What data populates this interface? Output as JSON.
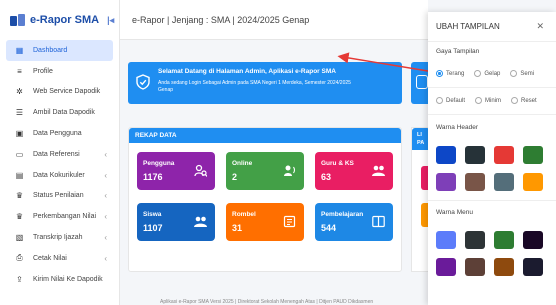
{
  "brand": {
    "name": "e-Rapor SMA",
    "toggle_icon": "sidebar-toggle-icon"
  },
  "header": {
    "breadcrumb": "e-Rapor | Jenjang : SMA | 2024/2025 Genap"
  },
  "sidebar": {
    "items": [
      {
        "label": "Dashboard",
        "icon": "dashboard-icon",
        "active": true,
        "has_submenu": false
      },
      {
        "label": "Profile",
        "icon": "profile-icon",
        "active": false,
        "has_submenu": false
      },
      {
        "label": "Web Service Dapodik",
        "icon": "gear-icon",
        "active": false,
        "has_submenu": false
      },
      {
        "label": "Ambil Data Dapodik",
        "icon": "database-icon",
        "active": false,
        "has_submenu": false
      },
      {
        "label": "Data Pengguna",
        "icon": "id-card-icon",
        "active": false,
        "has_submenu": false
      },
      {
        "label": "Data Referensi",
        "icon": "monitor-icon",
        "active": false,
        "has_submenu": true
      },
      {
        "label": "Data Kokurikuler",
        "icon": "calendar-icon",
        "active": false,
        "has_submenu": true
      },
      {
        "label": "Status Penilaian",
        "icon": "graduation-cap-icon",
        "active": false,
        "has_submenu": true
      },
      {
        "label": "Perkembangan Nilai",
        "icon": "graduation-cap-icon",
        "active": false,
        "has_submenu": true
      },
      {
        "label": "Transkrip Ijazah",
        "icon": "document-icon",
        "active": false,
        "has_submenu": true
      },
      {
        "label": "Cetak Nilai",
        "icon": "printer-icon",
        "active": false,
        "has_submenu": true
      },
      {
        "label": "Kirim Nilai Ke Dapodik",
        "icon": "upload-icon",
        "active": false,
        "has_submenu": false
      }
    ]
  },
  "banner": {
    "title": "Selamat Datang di Halaman Admin, Aplikasi e-Rapor SMA",
    "subtitle": "Anda sedang Login Sebagai Admin pada SMA Negeri 1 Merdeka, Semester 2024/2025 Genap"
  },
  "rekap": {
    "title": "REKAP DATA",
    "stats": [
      {
        "label": "Pengguna",
        "value": "1176",
        "color": "#8e24aa",
        "icon": "users-search-icon"
      },
      {
        "label": "Online",
        "value": "2",
        "color": "#43a047",
        "icon": "user-online-icon"
      },
      {
        "label": "Guru & KS",
        "value": "63",
        "color": "#e91e63",
        "icon": "teachers-icon"
      },
      {
        "label": "Siswa",
        "value": "1107",
        "color": "#1565c0",
        "icon": "students-icon"
      },
      {
        "label": "Rombel",
        "value": "31",
        "color": "#ff6f00",
        "icon": "rombel-icon"
      },
      {
        "label": "Pembelajaran",
        "value": "544",
        "color": "#1e88e5",
        "icon": "book-open-icon"
      }
    ],
    "side_title": "LI\nPA"
  },
  "panel": {
    "title": "UBAH TAMPILAN",
    "gaya_title": "Gaya Tampilan",
    "gaya_options": [
      {
        "label": "Terang",
        "checked": true
      },
      {
        "label": "Gelap",
        "checked": false
      },
      {
        "label": "Semi",
        "checked": false
      }
    ],
    "size_options": [
      {
        "label": "Default",
        "checked": false
      },
      {
        "label": "Minim",
        "checked": false
      },
      {
        "label": "Reset",
        "checked": false
      }
    ],
    "header_title": "Warna Header",
    "header_colors": [
      "#0d47c7",
      "#263238",
      "#e53935",
      "#2e7d32",
      "#7e3fb8",
      "#795548",
      "#546e7a",
      "#ff9800"
    ],
    "menu_title": "Warna Menu",
    "menu_colors": [
      "#5c7cfa",
      "#2d3436",
      "#2e7d32",
      "#1a0826",
      "#6a1b9a",
      "#5d4037",
      "#8e4a0e",
      "#1b1b2f"
    ]
  },
  "footer": {
    "text": "Aplikasi e-Rapor SMA Versi 2025 | Direktorat Sekolah Menengah Atas | Ditjen PAUD Dikdasmen"
  },
  "colors": {
    "accent": "#1f8ef1",
    "arrow": "#e53935"
  }
}
